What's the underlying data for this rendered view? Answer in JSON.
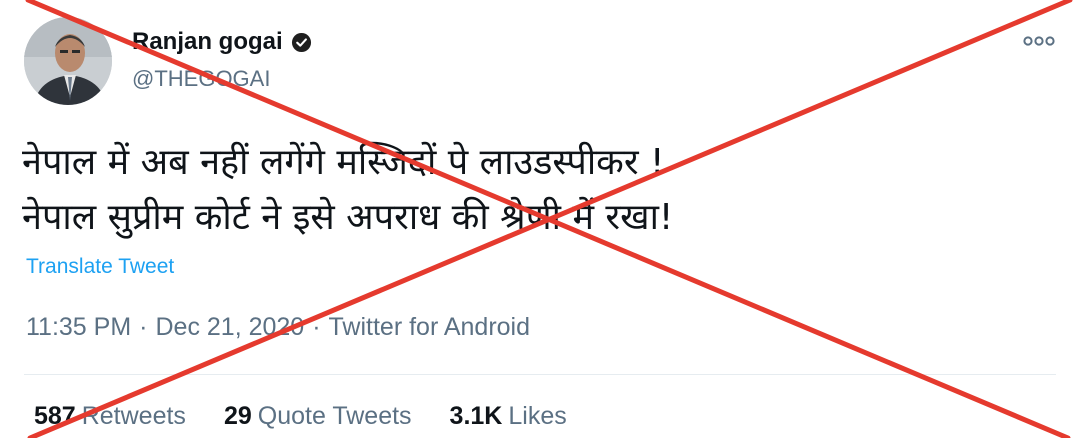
{
  "tweet": {
    "author": {
      "name": "Ranjan gogai",
      "handle": "@THEGOGAI"
    },
    "body_lines": [
      "नेपाल में अब नहीं लगेंगे मस्जिदों पे लाउडस्पीकर !",
      "नेपाल सुप्रीम कोर्ट ने इसे अपराध की श्रेणी में रखा!"
    ],
    "translate_label": "Translate Tweet",
    "time": "11:35 PM",
    "date": "Dec 21, 2020",
    "separator": "·",
    "source": "Twitter for Android",
    "stats": {
      "retweets_count": "587",
      "retweets_label": "Retweets",
      "quote_count": "29",
      "quote_label": "Quote Tweets",
      "likes_count": "3.1K",
      "likes_label": "Likes"
    }
  },
  "icons": {
    "more": "more-horizontal-icon",
    "badge": "verified-badge-icon",
    "overlay": "red-cross-overlay"
  },
  "colors": {
    "text": "#0f1419",
    "secondary": "#5b7083",
    "link": "#1da1f2",
    "cross": "#e53a2e"
  }
}
